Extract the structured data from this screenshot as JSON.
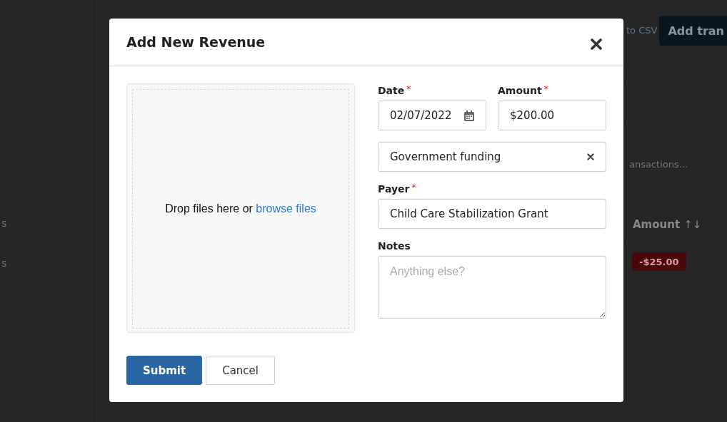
{
  "sidebar": {
    "items": [
      {
        "label": "s"
      },
      {
        "label": "s"
      }
    ]
  },
  "page": {
    "export_link": "to CSV",
    "add_button": "Add tran",
    "search": {
      "placeholder": "ansactions..."
    },
    "table": {
      "columns": [
        {
          "label": "Amount",
          "sort_icon": "↑↓"
        }
      ],
      "rows": [
        {
          "amount": "-$25.00"
        }
      ]
    }
  },
  "modal": {
    "title": "Add New Revenue",
    "dropzone": {
      "text": "Drop files here or ",
      "link": "browse files"
    },
    "fields": [
      {
        "kind": "date",
        "label": "Date",
        "required_mark": "*",
        "value": "02/07/2022"
      },
      {
        "kind": "text",
        "label": "Amount",
        "required_mark": "*",
        "value": "$200.00"
      },
      {
        "kind": "select",
        "value": "Government funding"
      },
      {
        "kind": "text",
        "label": "Payer",
        "required_mark": "*",
        "value": "Child Care Stabilization Grant"
      },
      {
        "kind": "textarea",
        "label": "Notes",
        "placeholder": "Anything else?"
      }
    ],
    "buttons": [
      {
        "label": "Submit",
        "primary": true
      },
      {
        "label": "Cancel",
        "primary": false
      }
    ]
  }
}
